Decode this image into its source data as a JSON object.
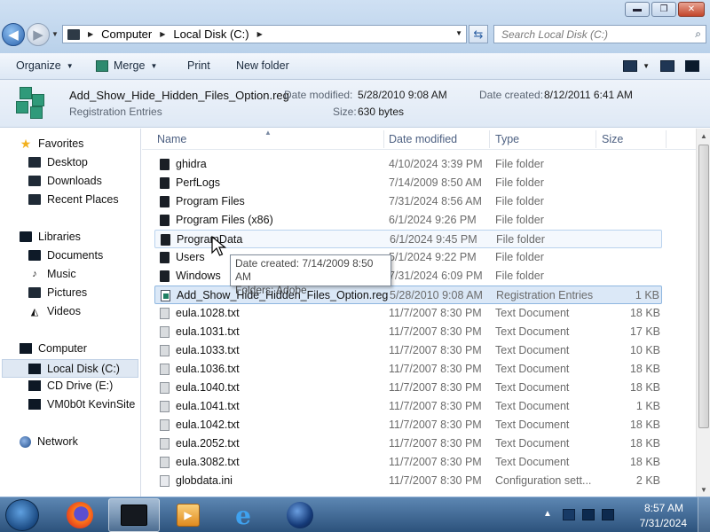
{
  "window": {
    "controls": {
      "minimize": "▬",
      "maximize": "❐",
      "close": "✕"
    }
  },
  "address": {
    "crumbs": [
      "Computer",
      "Local Disk (C:)"
    ],
    "search_placeholder": "Search Local Disk (C:)"
  },
  "toolbar": {
    "organize": "Organize",
    "merge": "Merge",
    "print": "Print",
    "new_folder": "New folder"
  },
  "details": {
    "file_name": "Add_Show_Hide_Hidden_Files_Option.reg",
    "file_type": "Registration Entries",
    "date_modified_label": "Date modified:",
    "date_modified": "5/28/2010 9:08 AM",
    "date_created_label": "Date created:",
    "date_created": "8/12/2011 6:41 AM",
    "size_label": "Size:",
    "size": "630 bytes"
  },
  "nav": {
    "favorites": "Favorites",
    "desktop": "Desktop",
    "downloads": "Downloads",
    "recent_places": "Recent Places",
    "libraries": "Libraries",
    "documents": "Documents",
    "music": "Music",
    "pictures": "Pictures",
    "videos": "Videos",
    "computer": "Computer",
    "local_disk": "Local Disk (C:)",
    "cd_drive": "CD Drive (E:)",
    "network_share": "VM0b0t KevinSite",
    "network": "Network"
  },
  "columns": {
    "name": "Name",
    "date_modified": "Date modified",
    "type": "Type",
    "size": "Size"
  },
  "files": [
    {
      "name": "ghidra",
      "date": "4/10/2024 3:39 PM",
      "type": "File folder",
      "size": "",
      "icon": "folder"
    },
    {
      "name": "PerfLogs",
      "date": "7/14/2009 8:50 AM",
      "type": "File folder",
      "size": "",
      "icon": "folder"
    },
    {
      "name": "Program Files",
      "date": "7/31/2024 8:56 AM",
      "type": "File folder",
      "size": "",
      "icon": "folder"
    },
    {
      "name": "Program Files (x86)",
      "date": "6/1/2024 9:26 PM",
      "type": "File folder",
      "size": "",
      "icon": "folder"
    },
    {
      "name": "ProgramData",
      "date": "6/1/2024 9:45 PM",
      "type": "File folder",
      "size": "",
      "icon": "folder"
    },
    {
      "name": "Users",
      "date": "5/1/2024 9:22 PM",
      "type": "File folder",
      "size": "",
      "icon": "folder"
    },
    {
      "name": "Windows",
      "date": "7/31/2024 6:09 PM",
      "type": "File folder",
      "size": "",
      "icon": "folder"
    },
    {
      "name": "Add_Show_Hide_Hidden_Files_Option.reg",
      "date": "5/28/2010 9:08 AM",
      "type": "Registration Entries",
      "size": "1 KB",
      "icon": "reg"
    },
    {
      "name": "eula.1028.txt",
      "date": "11/7/2007 8:30 PM",
      "type": "Text Document",
      "size": "18 KB",
      "icon": "doc"
    },
    {
      "name": "eula.1031.txt",
      "date": "11/7/2007 8:30 PM",
      "type": "Text Document",
      "size": "17 KB",
      "icon": "doc"
    },
    {
      "name": "eula.1033.txt",
      "date": "11/7/2007 8:30 PM",
      "type": "Text Document",
      "size": "10 KB",
      "icon": "doc"
    },
    {
      "name": "eula.1036.txt",
      "date": "11/7/2007 8:30 PM",
      "type": "Text Document",
      "size": "18 KB",
      "icon": "doc"
    },
    {
      "name": "eula.1040.txt",
      "date": "11/7/2007 8:30 PM",
      "type": "Text Document",
      "size": "18 KB",
      "icon": "doc"
    },
    {
      "name": "eula.1041.txt",
      "date": "11/7/2007 8:30 PM",
      "type": "Text Document",
      "size": "1 KB",
      "icon": "doc"
    },
    {
      "name": "eula.1042.txt",
      "date": "11/7/2007 8:30 PM",
      "type": "Text Document",
      "size": "18 KB",
      "icon": "doc"
    },
    {
      "name": "eula.2052.txt",
      "date": "11/7/2007 8:30 PM",
      "type": "Text Document",
      "size": "18 KB",
      "icon": "doc"
    },
    {
      "name": "eula.3082.txt",
      "date": "11/7/2007 8:30 PM",
      "type": "Text Document",
      "size": "18 KB",
      "icon": "doc"
    },
    {
      "name": "globdata.ini",
      "date": "11/7/2007 8:30 PM",
      "type": "Configuration sett...",
      "size": "2 KB",
      "icon": "ini"
    }
  ],
  "tooltip": {
    "line1": "Date created: 7/14/2009 8:50 AM",
    "line2": "Folders: Adobe"
  },
  "taskbar": {
    "time": "8:57 AM",
    "date": "7/31/2024"
  }
}
